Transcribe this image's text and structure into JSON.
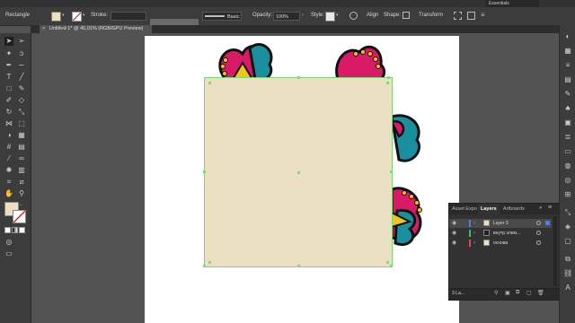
{
  "top_bar": {
    "workspace": "Essentials"
  },
  "control_bar": {
    "object_type": "Rectangle",
    "stroke_label": "Stroke:",
    "brush": "Basic",
    "opacity_label": "Opacity:",
    "opacity_value": "100%",
    "style_label": "Style:",
    "align_label": "Align",
    "shape_label": "Shape:",
    "transform_label": "Transform"
  },
  "document_tab": {
    "title": "Untitled-1* @ 45,01% (RGB/GPU Preview)",
    "close": "×"
  },
  "layers_panel": {
    "tabs": [
      "Asset Expo",
      "Layers",
      "Artboards"
    ],
    "menu_icon": "≡",
    "rows": [
      {
        "name": "Layer 3",
        "color": "#4a7bff",
        "selected": true
      },
      {
        "name": "внутр элем...",
        "color": "#3cbe5a",
        "selected": false
      },
      {
        "name": "основа",
        "color": "#e24a4a",
        "selected": false
      }
    ],
    "layer_count": "3 La..."
  },
  "colors": {
    "fill": "#ebe1c2",
    "selection": "#7ddc7d",
    "petal_pink": "#d81a67",
    "petal_teal": "#1a8fa0",
    "center_yellow": "#f2c418"
  }
}
